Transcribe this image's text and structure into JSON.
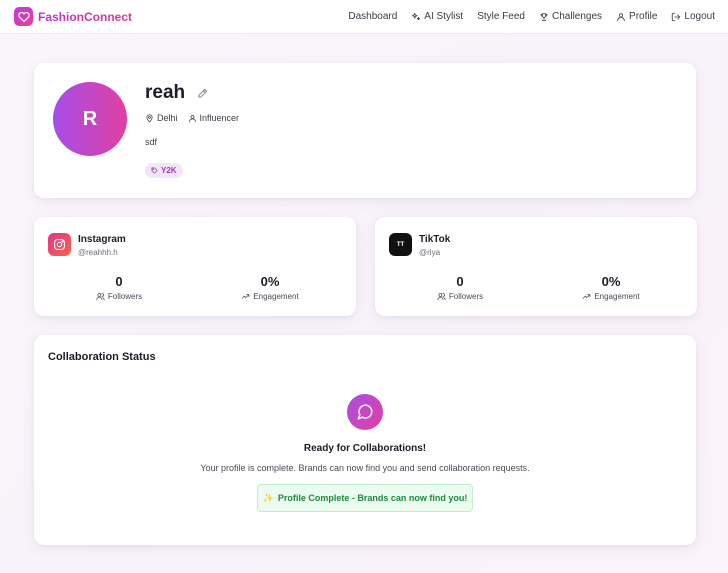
{
  "brand": {
    "name": "FashionConnect",
    "logo_icon": "heart-icon",
    "accent": "#c03cd8"
  },
  "nav": [
    {
      "label": "Dashboard",
      "icon": ""
    },
    {
      "label": "AI Stylist",
      "icon": "sparkles-icon"
    },
    {
      "label": "Style Feed",
      "icon": ""
    },
    {
      "label": "Challenges",
      "icon": "trophy-icon"
    },
    {
      "label": "Profile",
      "icon": "user-icon"
    },
    {
      "label": "Logout",
      "icon": "logout-icon"
    }
  ],
  "profile": {
    "initial": "R",
    "name": "reah",
    "location": "Delhi",
    "role": "Influencer",
    "bio": "sdf",
    "tag": "Y2K"
  },
  "socials": [
    {
      "platform": "Instagram",
      "handle": "@reahhh.h",
      "icon": "instagram-icon",
      "followers": "0",
      "followers_label": "Followers",
      "engagement": "0%",
      "engagement_label": "Engagement"
    },
    {
      "platform": "TikTok",
      "handle": "@riya",
      "icon": "tiktok-icon",
      "followers": "0",
      "followers_label": "Followers",
      "engagement": "0%",
      "engagement_label": "Engagement"
    }
  ],
  "collaboration": {
    "title": "Collaboration Status",
    "heading": "Ready for Collaborations!",
    "text": "Your profile is complete. Brands can now find you and send collaboration requests.",
    "badge": "Profile Complete - Brands can now find you!",
    "badge_emoji": "✨",
    "badge_color": "#1f8a3c"
  }
}
